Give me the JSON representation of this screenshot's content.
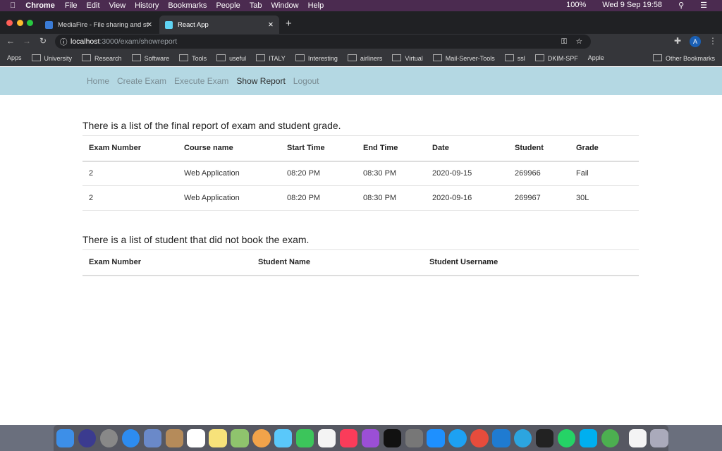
{
  "menubar": {
    "app": "Chrome",
    "items": [
      "File",
      "Edit",
      "View",
      "History",
      "Bookmarks",
      "People",
      "Tab",
      "Window",
      "Help"
    ],
    "battery": "100%",
    "clock": "Wed 9 Sep  19:58"
  },
  "tabs": [
    {
      "title": "MediaFire - File sharing and st",
      "active": false
    },
    {
      "title": "React App",
      "active": true
    }
  ],
  "address": {
    "host": "localhost",
    "path": ":3000/exam/showreport"
  },
  "bookmarks": [
    "Apps",
    "University",
    "Research",
    "Software",
    "Tools",
    "useful",
    "ITALY",
    "Interesting",
    "airliners",
    "Virtual",
    "Mail-Server-Tools",
    "ssl",
    "DKIM-SPF",
    "Apple"
  ],
  "other_bookmarks": "Other Bookmarks",
  "profile_initial": "A",
  "nav": {
    "items": [
      "Home",
      "Create Exam",
      "Execute Exam",
      "Show Report",
      "Logout"
    ],
    "active": "Show Report"
  },
  "report": {
    "heading": "There is a list of the final report of exam and student grade.",
    "columns": [
      "Exam Number",
      "Course name",
      "Start Time",
      "End Time",
      "Date",
      "Student",
      "Grade"
    ],
    "rows": [
      [
        "2",
        "Web Application",
        "08:20 PM",
        "08:30 PM",
        "2020-09-15",
        "269966",
        "Fail"
      ],
      [
        "2",
        "Web Application",
        "08:20 PM",
        "08:30 PM",
        "2020-09-16",
        "269967",
        "30L"
      ]
    ]
  },
  "notbooked": {
    "heading": "There is a list of student that did not book the exam.",
    "columns": [
      "Exam Number",
      "Student Name",
      "Student Username"
    ],
    "rows": []
  },
  "colors": {
    "navbar": "#b4d8e3",
    "menubar": "#4b2b50"
  }
}
